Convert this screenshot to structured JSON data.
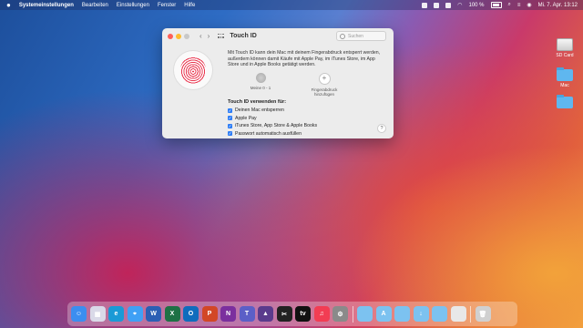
{
  "menubar": {
    "app_name": "Systemeinstellungen",
    "menus": [
      "Bearbeiten",
      "Einstellungen",
      "Fenster",
      "Hilfe"
    ],
    "battery_percent": "100 %",
    "datetime": "Mi. 7. Apr. 13:12"
  },
  "desktop": {
    "icons": [
      {
        "label": "SD Card",
        "icon": "drive-icon"
      },
      {
        "label": "Mac",
        "icon": "folder-icon"
      },
      {
        "label": "",
        "icon": "folder-icon"
      }
    ]
  },
  "window": {
    "title": "Touch ID",
    "search_placeholder": "Suchen",
    "intro_text": "Mit Touch ID kann dein Mac mit deinem Fingerabdruck entsperrt werden, außerdem können damit Käufe mit Apple Pay, im iTunes Store, im App Store und in Apple Books getätigt werden.",
    "fingerprints": [
      {
        "label": "Meine 0 - 1",
        "kind": "set"
      },
      {
        "label": "Fingerabdruck hinzufügen",
        "kind": "add"
      }
    ],
    "uses_title": "Touch ID verwenden für:",
    "uses": [
      {
        "label": "Deinen Mac entsperren",
        "checked": true
      },
      {
        "label": "Apple Pay",
        "checked": true
      },
      {
        "label": "iTunes Store, App Store & Apple Books",
        "checked": true
      },
      {
        "label": "Passwort automatisch ausfüllen",
        "checked": true
      }
    ],
    "help_label": "?"
  },
  "dock": {
    "apps": [
      {
        "name": "finder-icon",
        "glyph": "☺",
        "color": "#3b8ef0"
      },
      {
        "name": "launchpad-icon",
        "glyph": "▦",
        "color": "#d9d9e8"
      },
      {
        "name": "edge-icon",
        "glyph": "e",
        "color": "#1a9ad6"
      },
      {
        "name": "safari-icon",
        "glyph": "⌖",
        "color": "#3fa0f5"
      },
      {
        "name": "word-icon",
        "glyph": "W",
        "color": "#2b5fb4"
      },
      {
        "name": "excel-icon",
        "glyph": "X",
        "color": "#1e7145"
      },
      {
        "name": "outlook-icon",
        "glyph": "O",
        "color": "#0f6cbd"
      },
      {
        "name": "powerpoint-icon",
        "glyph": "P",
        "color": "#d24726"
      },
      {
        "name": "onenote-icon",
        "glyph": "N",
        "color": "#7b2f9e"
      },
      {
        "name": "teams-icon",
        "glyph": "T",
        "color": "#5b5fc7"
      },
      {
        "name": "affinity-icon",
        "glyph": "▲",
        "color": "#5a3b8c"
      },
      {
        "name": "final-cut-icon",
        "glyph": "✂",
        "color": "#222222"
      },
      {
        "name": "apple-tv-icon",
        "glyph": "tv",
        "color": "#111111"
      },
      {
        "name": "music-icon",
        "glyph": "♫",
        "color": "#f23d53"
      },
      {
        "name": "system-preferences-icon",
        "glyph": "⚙",
        "color": "#8a8a8a"
      },
      {
        "name": "folder-icon",
        "glyph": "",
        "color": "#7cc2f0"
      },
      {
        "name": "folder-apps-icon",
        "glyph": "A",
        "color": "#7cc2f0"
      },
      {
        "name": "folder-docs-icon",
        "glyph": "",
        "color": "#7cc2f0"
      },
      {
        "name": "folder-downloads-icon",
        "glyph": "↓",
        "color": "#7cc2f0"
      },
      {
        "name": "folder-files-icon",
        "glyph": "",
        "color": "#7cc2f0"
      },
      {
        "name": "window-preview-icon",
        "glyph": "",
        "color": "#e8e8e8"
      },
      {
        "name": "trash-icon",
        "glyph": "🗑",
        "color": "#d0d0d0"
      }
    ]
  }
}
